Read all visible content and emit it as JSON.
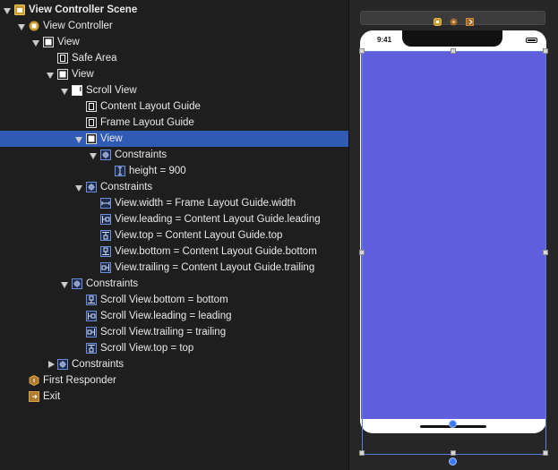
{
  "outline": {
    "rows": [
      {
        "label": "View Controller Scene",
        "depth": 0,
        "disclosure": "down",
        "icon": "scene-icon",
        "bold": true
      },
      {
        "label": "View Controller",
        "depth": 1,
        "disclosure": "down",
        "icon": "view-controller-icon"
      },
      {
        "label": "View",
        "depth": 2,
        "disclosure": "down",
        "icon": "view-icon"
      },
      {
        "label": "Safe Area",
        "depth": 3,
        "disclosure": "none",
        "icon": "layout-guide-icon"
      },
      {
        "label": "View",
        "depth": 3,
        "disclosure": "down",
        "icon": "view-icon"
      },
      {
        "label": "Scroll View",
        "depth": 4,
        "disclosure": "down",
        "icon": "scroll-view-icon"
      },
      {
        "label": "Content Layout Guide",
        "depth": 5,
        "disclosure": "none",
        "icon": "layout-guide-icon"
      },
      {
        "label": "Frame Layout Guide",
        "depth": 5,
        "disclosure": "none",
        "icon": "layout-guide-icon"
      },
      {
        "label": "View",
        "depth": 5,
        "disclosure": "down",
        "icon": "view-icon",
        "selected": true
      },
      {
        "label": "Constraints",
        "depth": 6,
        "disclosure": "down",
        "icon": "constraints-icon"
      },
      {
        "label": "height = 900",
        "depth": 7,
        "disclosure": "none",
        "icon": "height-constraint-icon"
      },
      {
        "label": "Constraints",
        "depth": 5,
        "disclosure": "down",
        "icon": "constraints-icon"
      },
      {
        "label": "View.width = Frame Layout Guide.width",
        "depth": 6,
        "disclosure": "none",
        "icon": "width-constraint-icon"
      },
      {
        "label": "View.leading = Content Layout Guide.leading",
        "depth": 6,
        "disclosure": "none",
        "icon": "leading-constraint-icon"
      },
      {
        "label": "View.top = Content Layout Guide.top",
        "depth": 6,
        "disclosure": "none",
        "icon": "top-constraint-icon"
      },
      {
        "label": "View.bottom = Content Layout Guide.bottom",
        "depth": 6,
        "disclosure": "none",
        "icon": "bottom-constraint-icon"
      },
      {
        "label": "View.trailing = Content Layout Guide.trailing",
        "depth": 6,
        "disclosure": "none",
        "icon": "trailing-constraint-icon"
      },
      {
        "label": "Constraints",
        "depth": 4,
        "disclosure": "down",
        "icon": "constraints-icon"
      },
      {
        "label": "Scroll View.bottom = bottom",
        "depth": 5,
        "disclosure": "none",
        "icon": "bottom-constraint-icon"
      },
      {
        "label": "Scroll View.leading = leading",
        "depth": 5,
        "disclosure": "none",
        "icon": "leading-constraint-icon"
      },
      {
        "label": "Scroll View.trailing = trailing",
        "depth": 5,
        "disclosure": "none",
        "icon": "trailing-constraint-icon"
      },
      {
        "label": "Scroll View.top = top",
        "depth": 5,
        "disclosure": "none",
        "icon": "top-constraint-icon"
      },
      {
        "label": "Constraints",
        "depth": 3,
        "disclosure": "right",
        "icon": "constraints-icon"
      },
      {
        "label": "First Responder",
        "depth": 1,
        "disclosure": "none",
        "icon": "first-responder-icon"
      },
      {
        "label": "Exit",
        "depth": 1,
        "disclosure": "none",
        "icon": "exit-icon"
      }
    ]
  },
  "canvas": {
    "status_time": "9:41",
    "view_background": "#5f5fdd",
    "selection_color": "#2f5bb5"
  }
}
